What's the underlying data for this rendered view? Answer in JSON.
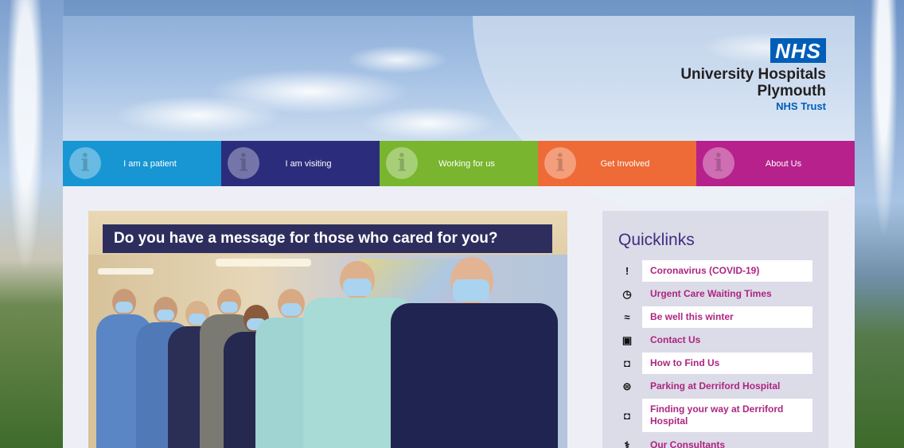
{
  "header": {
    "logo": {
      "badge": "NHS",
      "org_line1": "University Hospitals",
      "org_line2": "Plymouth",
      "trust": "NHS Trust"
    }
  },
  "nav": {
    "items": [
      {
        "label": "I am a patient",
        "color": "#1796d3"
      },
      {
        "label": "I am visiting",
        "color": "#2c2c7c"
      },
      {
        "label": "Working for us",
        "color": "#79b52e"
      },
      {
        "label": "Get Involved",
        "color": "#ee6a36"
      },
      {
        "label": "About Us",
        "color": "#b6218b"
      }
    ]
  },
  "hero": {
    "headline": "Do you have a message for those who cared for you?"
  },
  "quicklinks": {
    "title": "Quicklinks",
    "items": [
      {
        "label": "Coronavirus (COVID-19)",
        "icon": "exclamation-icon",
        "glyph": "!"
      },
      {
        "label": "Urgent Care Waiting Times",
        "icon": "clock-icon",
        "glyph": "◷"
      },
      {
        "label": "Be well this winter",
        "icon": "wind-icon",
        "glyph": "≈"
      },
      {
        "label": "Contact Us",
        "icon": "contact-card-icon",
        "glyph": "▣"
      },
      {
        "label": "How to Find Us",
        "icon": "map-pin-icon",
        "glyph": "◘"
      },
      {
        "label": "Parking at Derriford Hospital",
        "icon": "car-icon",
        "glyph": "⊜"
      },
      {
        "label": "Finding your way at Derriford Hospital",
        "icon": "map-pin-icon",
        "glyph": "◘"
      },
      {
        "label": "Our Consultants",
        "icon": "doctor-icon",
        "glyph": "⚕"
      }
    ]
  }
}
